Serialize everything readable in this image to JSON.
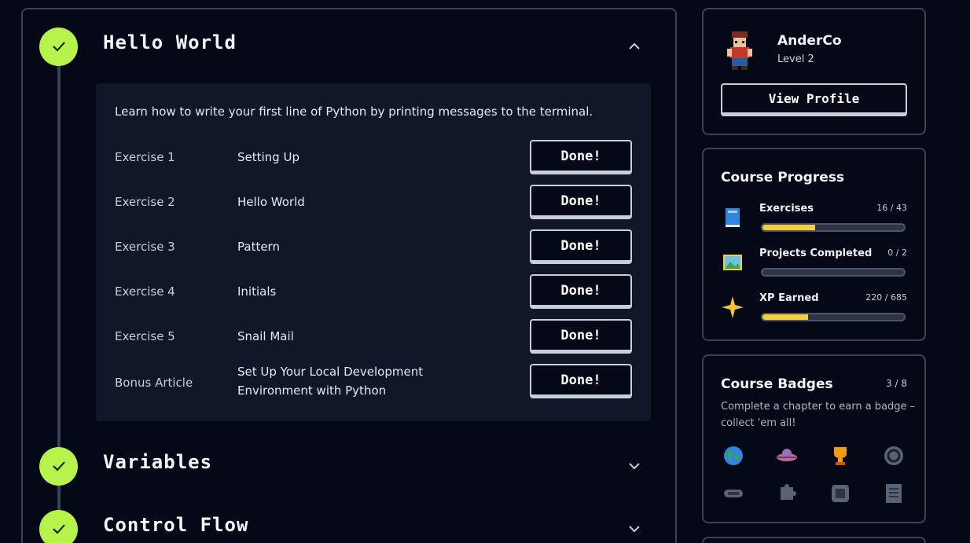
{
  "course": {
    "chapters": [
      {
        "title": "Hello World",
        "completed": true,
        "expanded": true
      },
      {
        "title": "Variables",
        "completed": true,
        "expanded": false
      },
      {
        "title": "Control Flow",
        "completed": true,
        "expanded": false
      }
    ],
    "description": "Learn how to write your first line of Python by printing messages to the terminal.",
    "exercises": [
      {
        "num": "Exercise 1",
        "name": "Setting Up",
        "button": "Done!"
      },
      {
        "num": "Exercise 2",
        "name": "Hello World",
        "button": "Done!"
      },
      {
        "num": "Exercise 3",
        "name": "Pattern",
        "button": "Done!"
      },
      {
        "num": "Exercise 4",
        "name": "Initials",
        "button": "Done!"
      },
      {
        "num": "Exercise 5",
        "name": "Snail Mail",
        "button": "Done!"
      },
      {
        "num": "Bonus Article",
        "name": "Set Up Your Local Development Environment with Python",
        "button": "Done!"
      }
    ]
  },
  "profile": {
    "username": "AnderCo",
    "level": "Level 2",
    "view_profile": "View Profile"
  },
  "progress": {
    "title": "Course Progress",
    "items": [
      {
        "label": "Exercises",
        "count": "16 / 43",
        "value": 16,
        "max": 43,
        "icon": "book-icon"
      },
      {
        "label": "Projects Completed",
        "count": "0 / 2",
        "value": 0,
        "max": 2,
        "icon": "picture-icon"
      },
      {
        "label": "XP Earned",
        "count": "220 / 685",
        "value": 220,
        "max": 685,
        "icon": "sparkle-icon"
      }
    ]
  },
  "badges": {
    "title": "Course Badges",
    "count": "3 / 8",
    "description": "Complete a chapter to earn a badge – collect 'em all!",
    "items": [
      "globe-badge-icon",
      "ufo-badge-icon",
      "trophy-badge-icon",
      "loop-badge-icon",
      "pill-badge-icon",
      "puzzle-badge-icon",
      "box-badge-icon",
      "document-badge-icon"
    ]
  },
  "colors": {
    "accent": "#b7f24a",
    "progress": "#f4d03f",
    "background": "#050816",
    "panel": "#0f1728",
    "border": "#3a4256"
  }
}
